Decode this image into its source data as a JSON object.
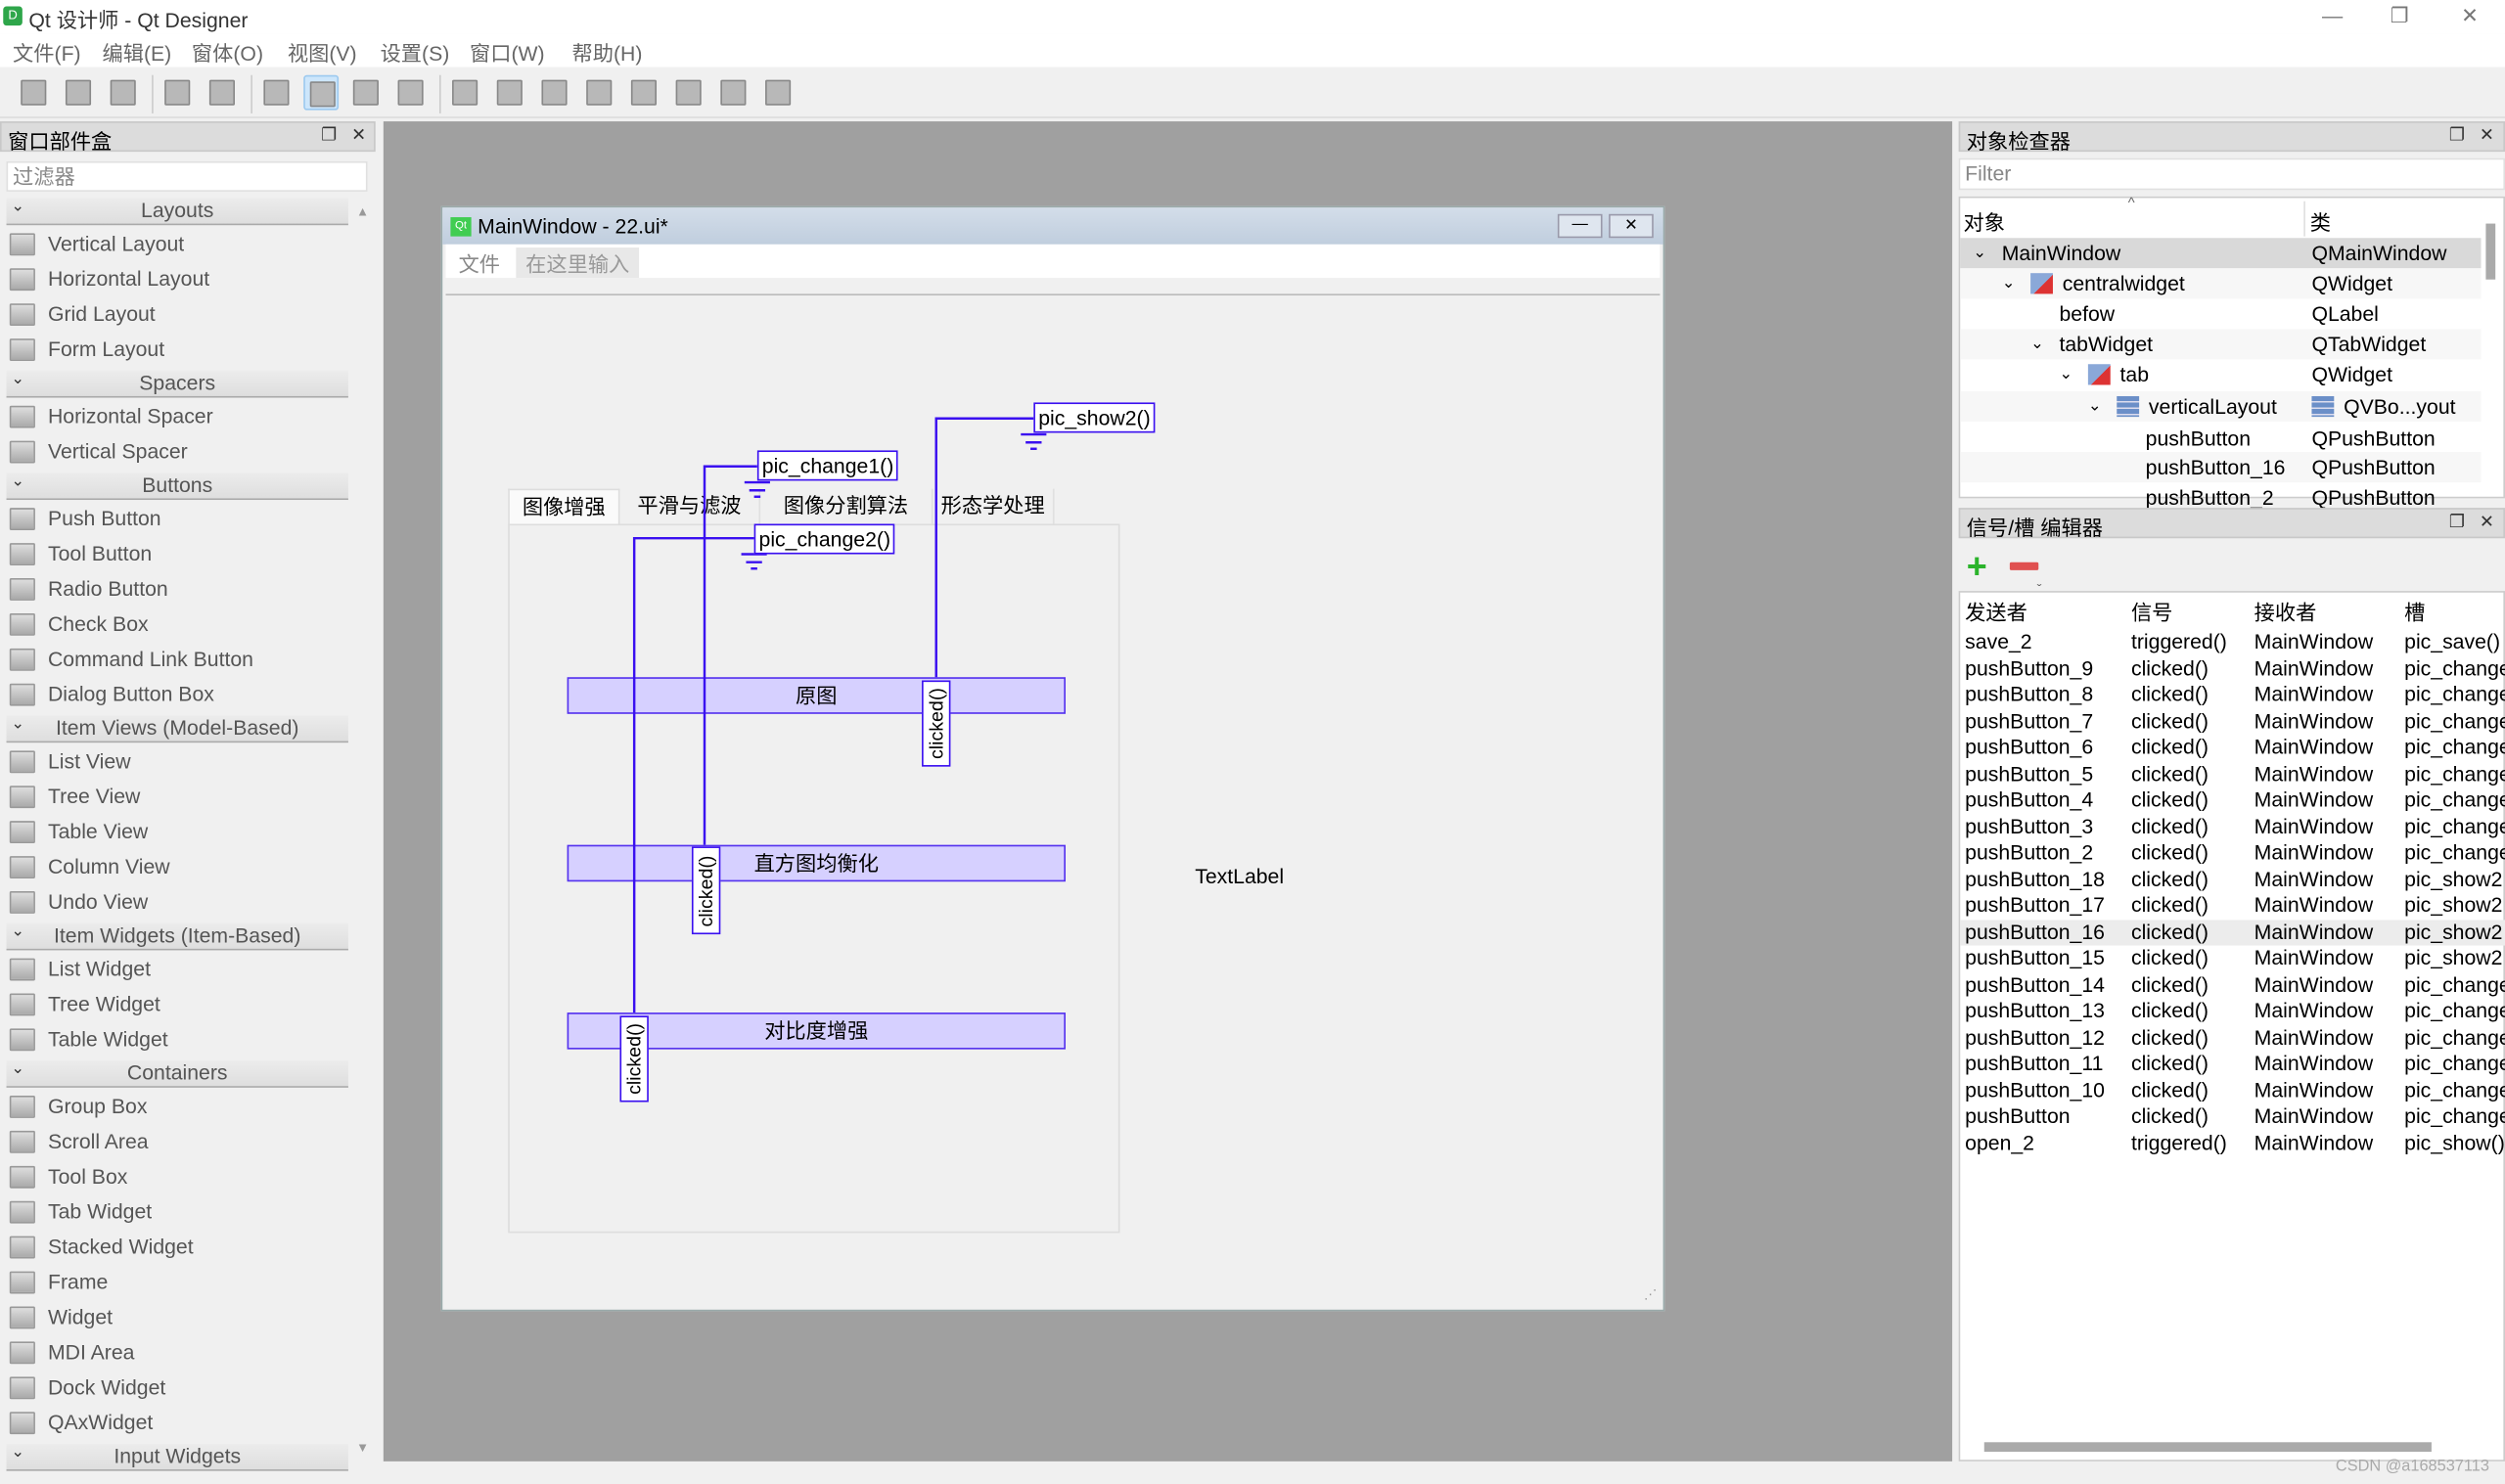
{
  "app": {
    "title": "Qt 设计师 - Qt Designer",
    "icon": "qt-designer-icon",
    "window_controls": [
      "—",
      "❐",
      "✕"
    ]
  },
  "menu": [
    "文件(F)",
    "编辑(E)",
    "窗体(O)",
    "视图(V)",
    "设置(S)",
    "窗口(W)",
    "帮助(H)"
  ],
  "toolbar": [
    "new-file-icon",
    "open-folder-icon",
    "save-icon",
    "|",
    "copy-icon",
    "paste-icon",
    "|",
    "edit-widgets-icon",
    "edit-signals-slots-icon",
    "edit-buddies-icon",
    "edit-tab-order-icon",
    "|",
    "layout-horizontal-icon",
    "layout-vertical-icon",
    "layout-horizontal-splitter-icon",
    "layout-vertical-splitter-icon",
    "layout-grid-icon",
    "layout-form-icon",
    "break-layout-icon",
    "adjust-size-icon"
  ],
  "toolbar_active": "edit-signals-slots-icon",
  "widget_box": {
    "title": "窗口部件盒",
    "filter_placeholder": "过滤器",
    "sections": [
      {
        "name": "Layouts",
        "items": [
          "Vertical Layout",
          "Horizontal Layout",
          "Grid Layout",
          "Form Layout"
        ]
      },
      {
        "name": "Spacers",
        "items": [
          "Horizontal Spacer",
          "Vertical Spacer"
        ]
      },
      {
        "name": "Buttons",
        "items": [
          "Push Button",
          "Tool Button",
          "Radio Button",
          "Check Box",
          "Command Link Button",
          "Dialog Button Box"
        ]
      },
      {
        "name": "Item Views (Model-Based)",
        "items": [
          "List View",
          "Tree View",
          "Table View",
          "Column View",
          "Undo View"
        ]
      },
      {
        "name": "Item Widgets (Item-Based)",
        "items": [
          "List Widget",
          "Tree Widget",
          "Table Widget"
        ]
      },
      {
        "name": "Containers",
        "items": [
          "Group Box",
          "Scroll Area",
          "Tool Box",
          "Tab Widget",
          "Stacked Widget",
          "Frame",
          "Widget",
          "MDI Area",
          "Dock Widget",
          "QAxWidget"
        ]
      },
      {
        "name": "Input Widgets",
        "items": []
      }
    ]
  },
  "form": {
    "title": "MainWindow - 22.ui*",
    "menu": [
      "文件",
      "在这里输入"
    ],
    "tabs": [
      "图像增强",
      "平滑与滤波",
      "图像分割算法",
      "形态学处理"
    ],
    "buttons": [
      "原图",
      "直方图均衡化",
      "对比度增强"
    ],
    "label": "TextLabel",
    "connections": [
      {
        "signal": "clicked()",
        "slot": "pic_show2()"
      },
      {
        "signal": "clicked()",
        "slot": "pic_change1()"
      },
      {
        "signal": "clicked()",
        "slot": "pic_change2()"
      }
    ],
    "connection_color": "#3a10f0"
  },
  "object_inspector": {
    "title": "对象检查器",
    "filter_placeholder": "Filter",
    "columns": [
      "对象",
      "类"
    ],
    "rows": [
      {
        "name": "MainWindow",
        "cls": "QMainWindow",
        "depth": 0,
        "expand": true
      },
      {
        "name": "centralwidget",
        "cls": "QWidget",
        "depth": 1,
        "expand": true,
        "icon": "widget-no-layout-icon"
      },
      {
        "name": "befow",
        "cls": "QLabel",
        "depth": 2
      },
      {
        "name": "tabWidget",
        "cls": "QTabWidget",
        "depth": 2,
        "expand": true
      },
      {
        "name": "tab",
        "cls": "QWidget",
        "depth": 3,
        "expand": true,
        "icon": "widget-no-layout-icon"
      },
      {
        "name": "verticalLayout",
        "cls": "QVBo...yout",
        "depth": 4,
        "expand": true,
        "icon": "vertical-layout-icon"
      },
      {
        "name": "pushButton",
        "cls": "QPushButton",
        "depth": 5
      },
      {
        "name": "pushButton_16",
        "cls": "QPushButton",
        "depth": 5
      },
      {
        "name": "pushButton_2",
        "cls": "QPushButton",
        "depth": 5
      }
    ]
  },
  "signal_slot_editor": {
    "title": "信号/槽 编辑器",
    "columns": [
      "发送者",
      "信号",
      "接收者",
      "槽"
    ],
    "selected": 11,
    "rows": [
      [
        "save_2",
        "triggered()",
        "MainWindow",
        "pic_save()"
      ],
      [
        "pushButton_9",
        "clicked()",
        "MainWindow",
        "pic_change"
      ],
      [
        "pushButton_8",
        "clicked()",
        "MainWindow",
        "pic_change"
      ],
      [
        "pushButton_7",
        "clicked()",
        "MainWindow",
        "pic_change"
      ],
      [
        "pushButton_6",
        "clicked()",
        "MainWindow",
        "pic_change"
      ],
      [
        "pushButton_5",
        "clicked()",
        "MainWindow",
        "pic_change"
      ],
      [
        "pushButton_4",
        "clicked()",
        "MainWindow",
        "pic_change"
      ],
      [
        "pushButton_3",
        "clicked()",
        "MainWindow",
        "pic_change"
      ],
      [
        "pushButton_2",
        "clicked()",
        "MainWindow",
        "pic_change"
      ],
      [
        "pushButton_18",
        "clicked()",
        "MainWindow",
        "pic_show2"
      ],
      [
        "pushButton_17",
        "clicked()",
        "MainWindow",
        "pic_show2"
      ],
      [
        "pushButton_16",
        "clicked()",
        "MainWindow",
        "pic_show2"
      ],
      [
        "pushButton_15",
        "clicked()",
        "MainWindow",
        "pic_show2"
      ],
      [
        "pushButton_14",
        "clicked()",
        "MainWindow",
        "pic_change"
      ],
      [
        "pushButton_13",
        "clicked()",
        "MainWindow",
        "pic_change"
      ],
      [
        "pushButton_12",
        "clicked()",
        "MainWindow",
        "pic_change"
      ],
      [
        "pushButton_11",
        "clicked()",
        "MainWindow",
        "pic_change"
      ],
      [
        "pushButton_10",
        "clicked()",
        "MainWindow",
        "pic_change"
      ],
      [
        "pushButton",
        "clicked()",
        "MainWindow",
        "pic_change"
      ],
      [
        "open_2",
        "triggered()",
        "MainWindow",
        "pic_show()"
      ]
    ]
  },
  "watermark": "CSDN @a168537113"
}
